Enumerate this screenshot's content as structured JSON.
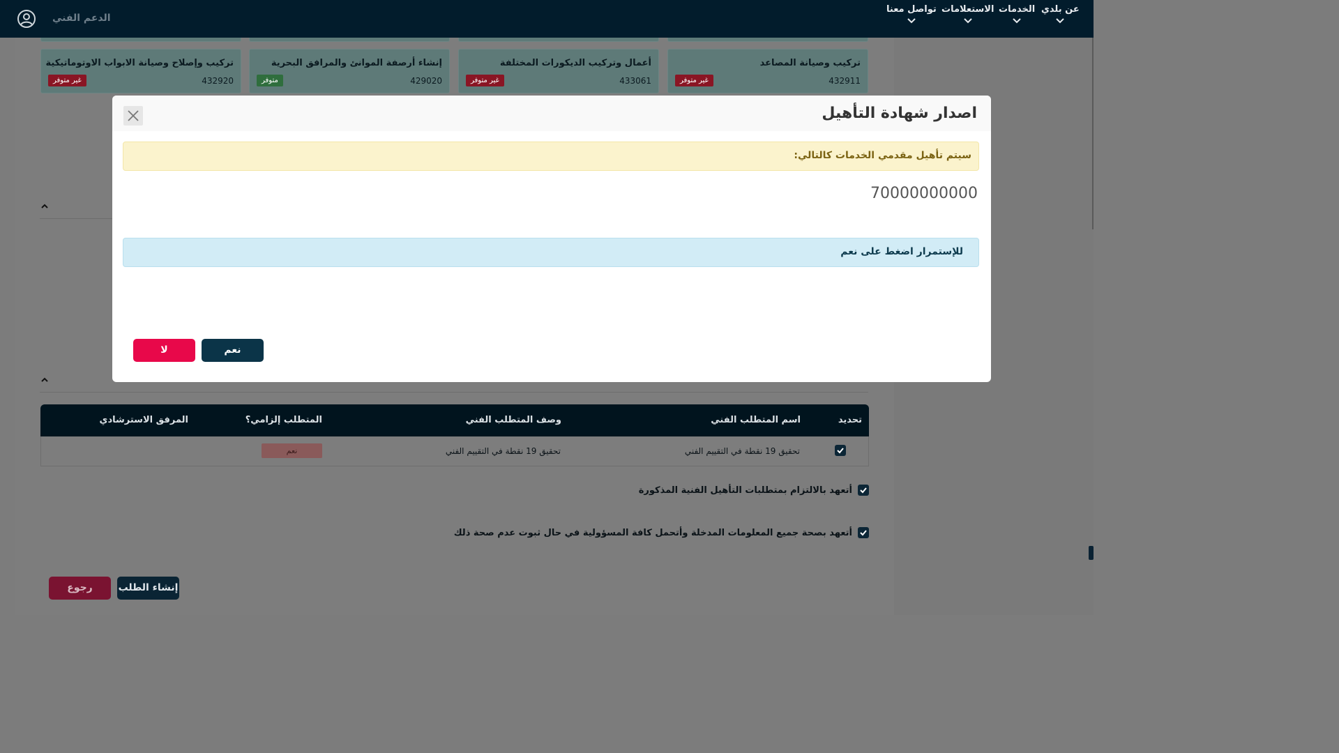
{
  "nav": {
    "items": [
      {
        "label": "عن بلدي"
      },
      {
        "label": "الخدمات"
      },
      {
        "label": "الاستعلامات"
      },
      {
        "label": "تواصل معنا"
      }
    ],
    "support_label": "الدعم الفني",
    "user_icon": "user-circle-icon"
  },
  "cards": [
    {
      "title": "تركيب وصيانة المصاعد",
      "code": "432911",
      "status": "غير متوفر",
      "status_color": "#8a1524"
    },
    {
      "title": "أعمال وتركيب الديكورات المختلفة",
      "code": "433061",
      "status": "غير متوفر",
      "status_color": "#8a1524"
    },
    {
      "title": "إنشاء أرصفة الموانئ والمرافق البحرية",
      "code": "429020",
      "status": "متوفر",
      "status_color": "#2f6e3d"
    },
    {
      "title": "تركيب وإصلاح وصيانة الابواب الاوتوماتيكية",
      "code": "432920",
      "status": "غير متوفر",
      "status_color": "#8a1524"
    }
  ],
  "table": {
    "headers": {
      "select": "تحديد",
      "name": "اسم المتطلب الفني",
      "description": "وصف المتطلب الفني",
      "mandatory": "المتطلب إلزامي؟",
      "attachment": "المرفق الاسترشادي"
    },
    "rows": [
      {
        "name": "تحقيق 19 نقطة في التقييم الفني",
        "description": "تحقيق 19 نقطة في التقييم الفني",
        "mandatory": "نعم",
        "checked": true
      }
    ]
  },
  "commitments": [
    {
      "label": "أتعهد بالالتزام بمتطلبات التأهيل الفنية المذكورة",
      "checked": true
    },
    {
      "label": "أتعهد بصحة جميع المعلومات المدخلة وأتحمل كافة المسؤولية في حال ثبوت عدم صحة ذلك",
      "checked": true
    }
  ],
  "buttons": {
    "create_request": "إنشاء الطلب",
    "back": "رجوع"
  },
  "modal": {
    "title": "اصدار شهادة التأهيل",
    "warning": "سيتم تأهيل مقدمي الخدمات كالتالي:",
    "provider_number": "70000000000",
    "info": "للإستمرار اضغط على نعم",
    "yes_label": "نعم",
    "no_label": "لا"
  },
  "colors": {
    "navbar": "#021c2c",
    "primary": "#0b3448",
    "danger": "#e8084a",
    "warning_bg": "#fbf3cd",
    "info_bg": "#d2ecf6"
  }
}
